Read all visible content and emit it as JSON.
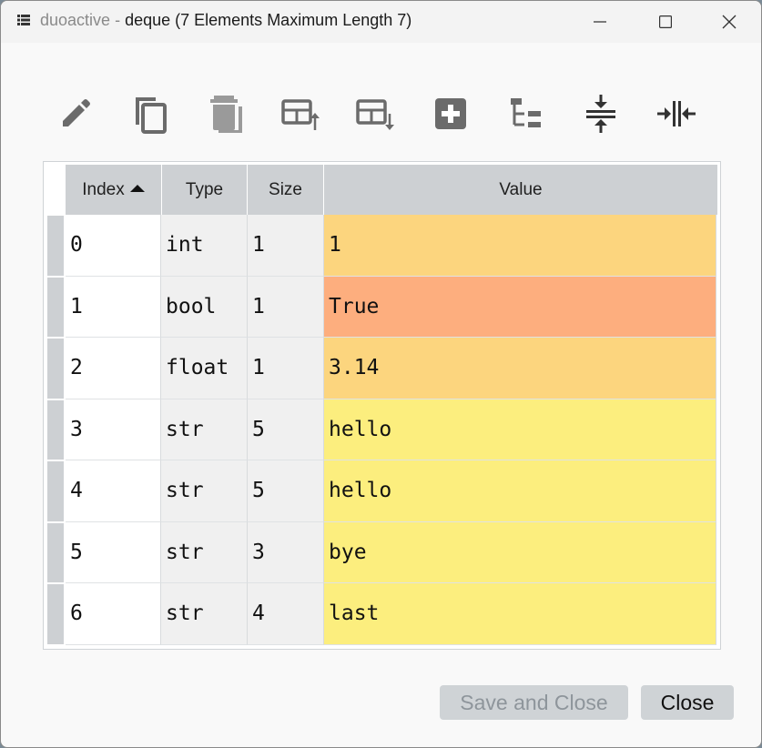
{
  "window": {
    "app_name": "duoactive",
    "separator": "-",
    "title": "deque (7 Elements Maximum Length 7)"
  },
  "toolbar": {
    "buttons": [
      {
        "name": "edit-icon"
      },
      {
        "name": "copy-icon"
      },
      {
        "name": "delete-icon"
      },
      {
        "name": "insert-above-icon"
      },
      {
        "name": "insert-below-icon"
      },
      {
        "name": "add-icon"
      },
      {
        "name": "tree-view-icon"
      },
      {
        "name": "collapse-vertical-icon"
      },
      {
        "name": "collapse-horizontal-icon"
      }
    ]
  },
  "table": {
    "headers": {
      "index": "Index",
      "type": "Type",
      "size": "Size",
      "value": "Value"
    },
    "sort": {
      "column": "index",
      "direction": "ascending"
    },
    "rows": [
      {
        "index": "0",
        "type": "int",
        "size": "1",
        "value": "1",
        "color": "#fcd57e"
      },
      {
        "index": "1",
        "type": "bool",
        "size": "1",
        "value": "True",
        "color": "#fdae7e"
      },
      {
        "index": "2",
        "type": "float",
        "size": "1",
        "value": "3.14",
        "color": "#fcd57e"
      },
      {
        "index": "3",
        "type": "str",
        "size": "5",
        "value": "hello",
        "color": "#fcee7e"
      },
      {
        "index": "4",
        "type": "str",
        "size": "5",
        "value": "hello",
        "color": "#fcee7e"
      },
      {
        "index": "5",
        "type": "str",
        "size": "3",
        "value": "bye",
        "color": "#fcee7e"
      },
      {
        "index": "6",
        "type": "str",
        "size": "4",
        "value": "last",
        "color": "#fcee7e"
      }
    ]
  },
  "footer": {
    "save_close_label": "Save and Close",
    "close_label": "Close"
  }
}
